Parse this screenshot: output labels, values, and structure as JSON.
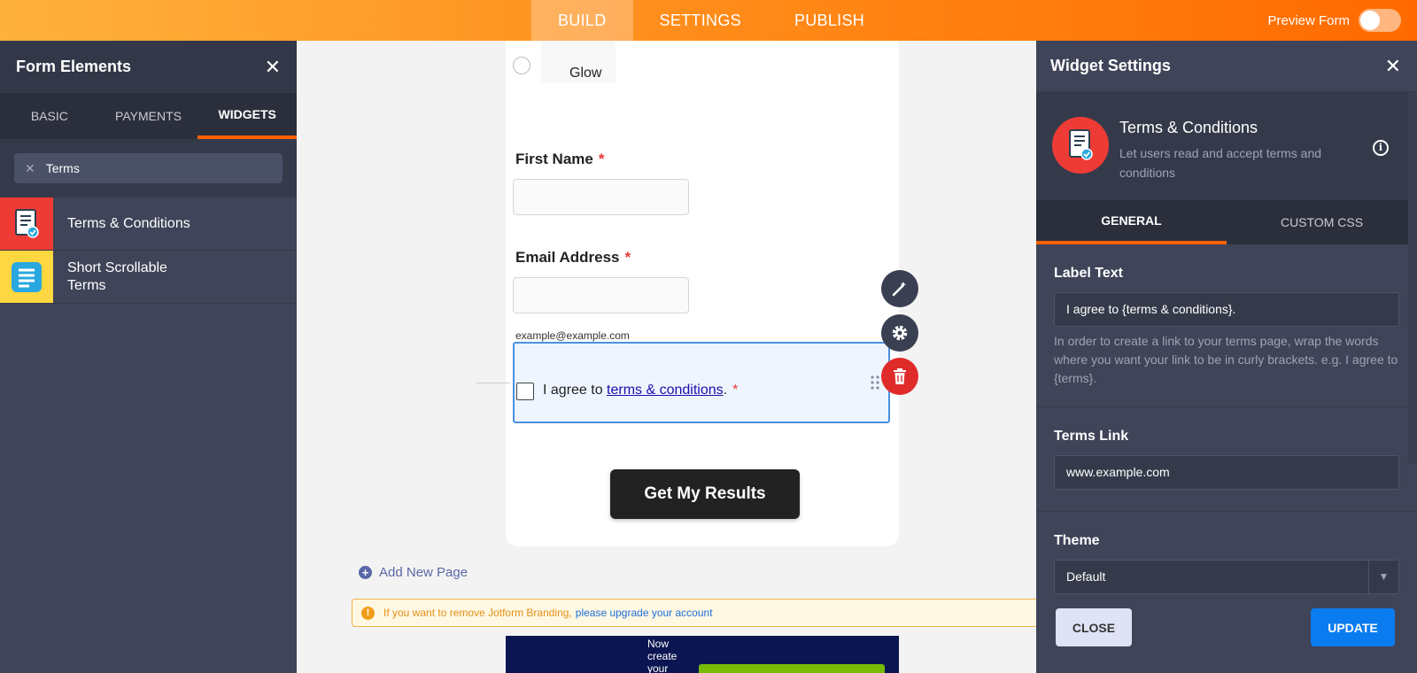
{
  "topbar": {
    "tabs": [
      {
        "label": "BUILD",
        "active": true
      },
      {
        "label": "SETTINGS",
        "active": false
      },
      {
        "label": "PUBLISH",
        "active": false
      }
    ],
    "preview_label": "Preview Form",
    "preview_on": false
  },
  "left_panel": {
    "title": "Form Elements",
    "tabs": [
      "BASIC",
      "PAYMENTS",
      "WIDGETS"
    ],
    "active_tab": "WIDGETS",
    "search_value": "Terms",
    "items": [
      {
        "label": "Terms & Conditions",
        "icon": "document-check-icon",
        "icon_bg": "#ef3b36"
      },
      {
        "label": "Short Scrollable Terms",
        "icon": "scroll-list-icon",
        "icon_bg": "#ffd740"
      }
    ]
  },
  "form": {
    "glow_option": "Glow",
    "first_name_label": "First Name",
    "email_label": "Email Address",
    "required_mark": "*",
    "email_hint": "example@example.com",
    "terms_prefix": "I agree to ",
    "terms_link": "terms & conditions",
    "terms_suffix": ".",
    "submit_label": "Get My Results"
  },
  "canvas": {
    "add_page_label": "Add New Page",
    "branding_text": "If you want to remove Jotform Branding,",
    "branding_link": "please upgrade your account",
    "ad_text": "Now create your"
  },
  "right_panel": {
    "title": "Widget Settings",
    "widget_title": "Terms & Conditions",
    "widget_desc": "Let users read and accept terms and conditions",
    "tabs": [
      "GENERAL",
      "CUSTOM CSS"
    ],
    "active_tab": "GENERAL",
    "label_text_title": "Label Text",
    "label_text_value": "I agree to {terms & conditions}.",
    "label_text_help": "In order to create a link to your terms page, wrap the words where you want your link to be in curly brackets. e.g. I agree to {terms}.",
    "terms_link_title": "Terms Link",
    "terms_link_value": "www.example.com",
    "theme_title": "Theme",
    "theme_value": "Default",
    "close_label": "CLOSE",
    "update_label": "UPDATE"
  },
  "colors": {
    "accent": "#ff6100",
    "panel": "#3f4458",
    "update_blue": "#0a7cf0",
    "delete_red": "#e02b2b"
  }
}
